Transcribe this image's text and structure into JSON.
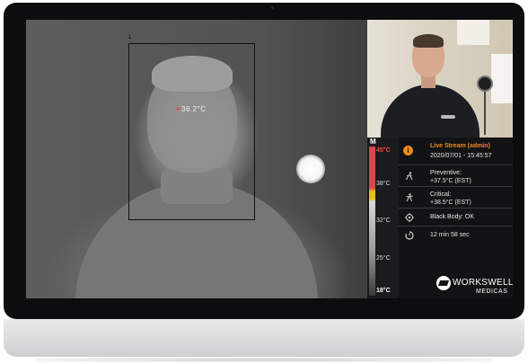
{
  "thermal_view": {
    "box_id": "1",
    "temperature_reading": "36.2°C"
  },
  "scale": {
    "mode": "M",
    "labels": [
      "45°C",
      "38°C",
      "32°C",
      "25°C",
      "18°C"
    ]
  },
  "panel": {
    "stream_title": "Live Stream (admin)",
    "stream_datetime": "2020/07/01 - 15:45:57",
    "preventive_label": "Preventive:",
    "preventive_value": "+37.5°C (EST)",
    "critical_label": "Critical:",
    "critical_value": "+38.5°C (EST)",
    "black_body": "Black Body: OK",
    "elapsed": "12 min 58 sec",
    "brand_name": "WORKSWELL",
    "brand_sub": "MEDICAS"
  },
  "colors": {
    "accent": "#ef8a1a",
    "scale_hot": "#d44a4a",
    "scale_warn": "#e7c01a"
  },
  "icons": {
    "info": "info-icon",
    "preventive": "person-walking-icon",
    "critical": "person-alert-icon",
    "black_body": "target-icon",
    "elapsed": "timer-icon"
  }
}
